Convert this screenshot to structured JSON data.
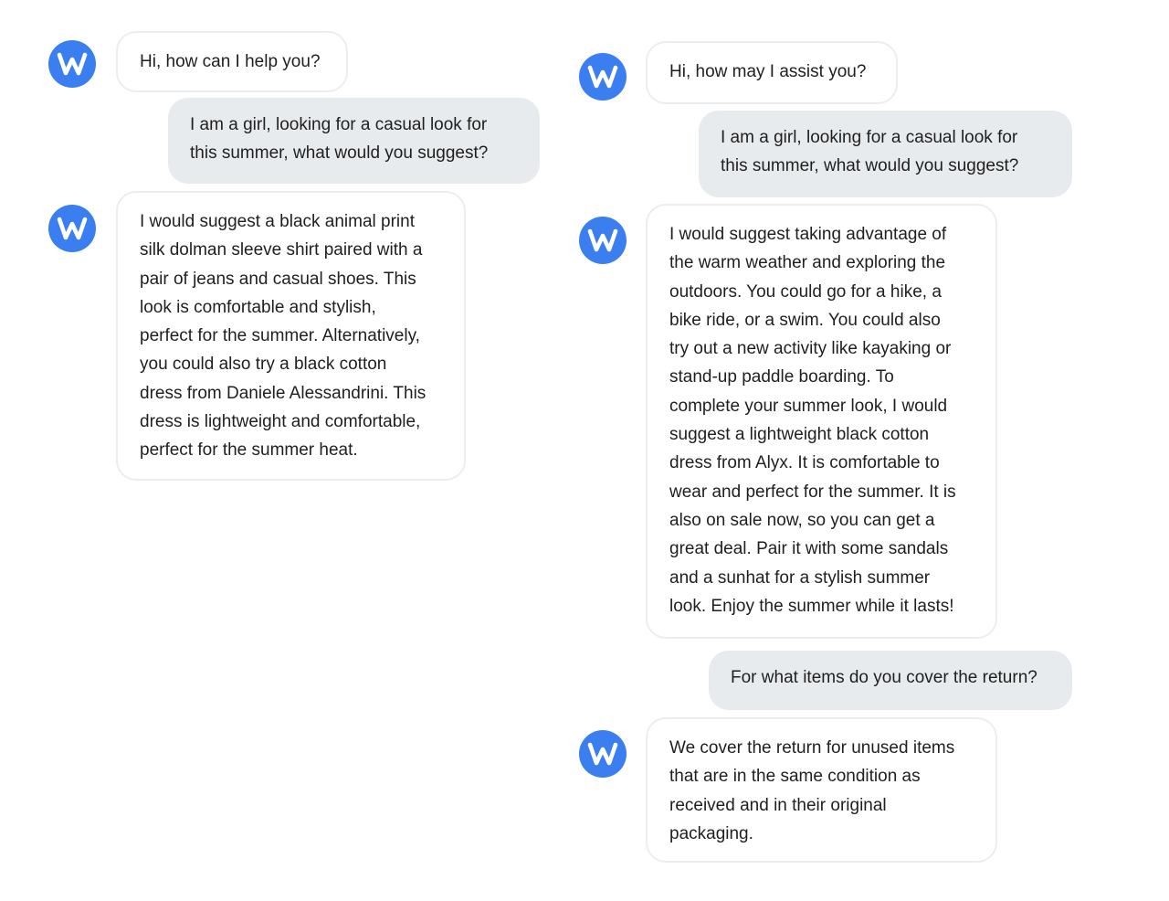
{
  "brand": {
    "avatar_icon": "w-logo-icon",
    "avatar_color": "#3b7ef0",
    "user_bubble_color": "#e8ebee",
    "bot_bubble_border": "#ebedf0"
  },
  "left_conversation": {
    "messages": [
      {
        "sender": "bot",
        "text": "Hi, how can I help you?"
      },
      {
        "sender": "user",
        "text": "I am a girl, looking for a casual look for\nthis summer, what would you suggest?"
      },
      {
        "sender": "bot",
        "text": "I would suggest a black animal print\nsilk dolman sleeve shirt paired with a\npair of jeans and casual shoes. This\nlook is comfortable and stylish,\nperfect for the summer. Alternatively,\nyou could also try a black cotton\ndress from Daniele Alessandrini. This\ndress is lightweight and comfortable,\nperfect for the summer heat."
      }
    ]
  },
  "right_conversation": {
    "messages": [
      {
        "sender": "bot",
        "text": "Hi, how may I assist you?"
      },
      {
        "sender": "user",
        "text": "I am a girl, looking for a casual look for\nthis summer, what would you suggest?"
      },
      {
        "sender": "bot",
        "text": "I would suggest taking advantage of\nthe warm weather and exploring the\noutdoors. You could go for a hike, a\nbike ride, or a swim. You could also\ntry out a new activity like kayaking or\nstand-up paddle boarding. To\ncomplete your summer look, I would\nsuggest a lightweight black cotton\ndress from Alyx. It is comfortable to\nwear and perfect for the summer. It is\nalso on sale now, so you can get a\ngreat deal. Pair it with some sandals\nand a sunhat for a stylish summer\nlook. Enjoy the summer while it lasts!"
      },
      {
        "sender": "user",
        "text": "For what items do you cover the return?"
      },
      {
        "sender": "bot",
        "text": "We cover the return for unused items\nthat are in the same condition as\nreceived and in their original\npackaging."
      }
    ]
  }
}
